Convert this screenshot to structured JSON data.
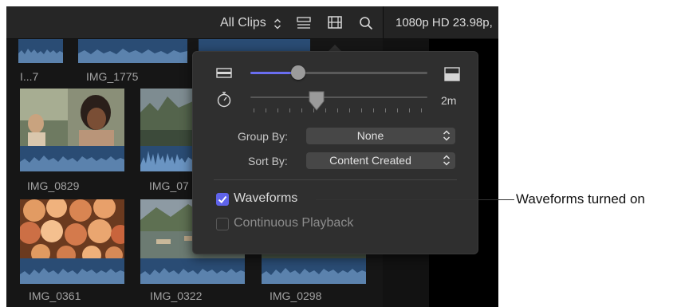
{
  "toolbar": {
    "clips_filter": "All Clips",
    "viewer_format": "1080p HD 23.98p,",
    "icons": [
      "updown-chevron-icon",
      "list-view-icon",
      "filmstrip-icon",
      "search-icon"
    ]
  },
  "clips": [
    {
      "label": "I...7"
    },
    {
      "label": "IMG_1775"
    },
    {
      "label": "IMG_0829"
    },
    {
      "label": "IMG_07"
    },
    {
      "label": "IMG_0361"
    },
    {
      "label": "IMG_0322"
    },
    {
      "label": "IMG_0298"
    }
  ],
  "popup": {
    "clip_height_slider_level": 0.27,
    "duration_value": "2m",
    "group_by": {
      "label": "Group By:",
      "value": "None"
    },
    "sort_by": {
      "label": "Sort By:",
      "value": "Content Created"
    },
    "waveforms": {
      "label": "Waveforms",
      "checked": true
    },
    "continuous_playback": {
      "label": "Continuous Playback",
      "checked": false
    }
  },
  "callout": {
    "text": "Waveforms turned on"
  },
  "colors": {
    "accent": "#5f63ea",
    "waveform": "#2a4c74",
    "panel": "#2f2f2f",
    "background": "#161616"
  }
}
